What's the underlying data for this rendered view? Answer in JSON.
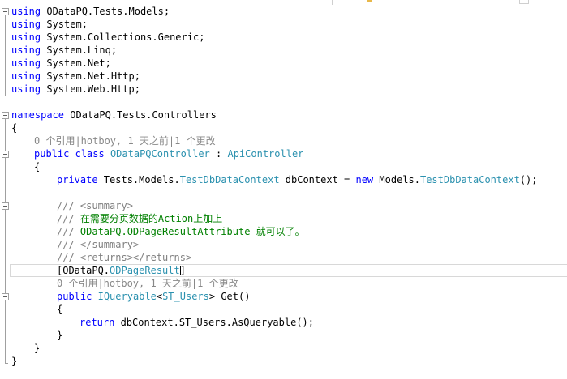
{
  "code": {
    "usings": [
      {
        "kw": "using",
        "ns": " ODataPQ.Tests.Models;"
      },
      {
        "kw": "using",
        "ns": " System;"
      },
      {
        "kw": "using",
        "ns": " System.Collections.Generic;"
      },
      {
        "kw": "using",
        "ns": " System.Linq;"
      },
      {
        "kw": "using",
        "ns": " System.Net;"
      },
      {
        "kw": "using",
        "ns": " System.Net.Http;"
      },
      {
        "kw": "using",
        "ns": " System.Web.Http;"
      }
    ],
    "namespace_kw": "namespace",
    "namespace_name": " ODataPQ.Tests.Controllers",
    "open_brace": "{",
    "close_brace": "}",
    "class_lens": "0 个引用|hotboy, 1 天之前|1 个更改",
    "class_kw_public": "public",
    "class_kw_class": "class",
    "class_name": "ODataPQController",
    "class_sep": " : ",
    "class_base": "ApiController",
    "field_kw_private": "private",
    "field_ns": " Tests.Models.",
    "field_type": "TestDbDataContext",
    "field_name": " dbContext = ",
    "field_kw_new": "new",
    "field_ns2": " Models.",
    "field_type2": "TestDbDataContext",
    "field_end": "();",
    "doc_prefix": "/// ",
    "doc_summary_open": "<summary>",
    "doc_line1": "在需要分页数据的Action上加上",
    "doc_line2": "ODataPQ.ODPageResultAttribute 就可以了。",
    "doc_summary_close": "</summary>",
    "doc_returns": "<returns></returns>",
    "attr_open": "[ODataPQ.",
    "attr_type": "ODPageResult",
    "attr_close": "]",
    "method_lens": "0 个引用|hotboy, 1 天之前|1 个更改",
    "method_kw_public": "public",
    "method_type1": "IQueryable",
    "method_lt": "<",
    "method_type2": "ST_Users",
    "method_rest": "> Get()",
    "return_kw": "return",
    "return_rest": " dbContext.ST_Users.AsQueryable();"
  }
}
